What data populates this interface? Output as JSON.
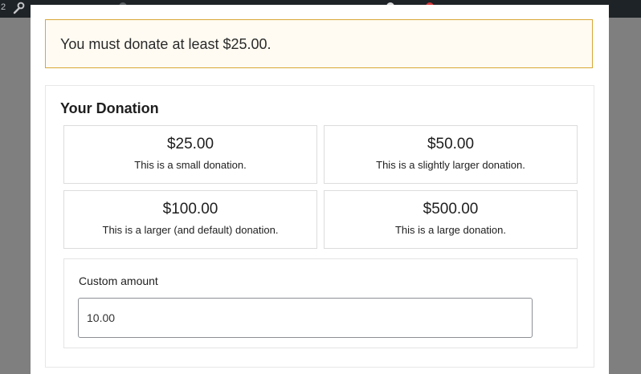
{
  "topbar": {
    "counter": "2",
    "wrench_icon": "wrench-icon",
    "bg_color": "#1d2327"
  },
  "notice": {
    "message": "You must donate at least $25.00.",
    "border_color": "#d9a736"
  },
  "donation": {
    "title": "Your Donation",
    "tiers": [
      {
        "price": "$25.00",
        "description": "This is a small donation."
      },
      {
        "price": "$50.00",
        "description": "This is a slightly larger donation."
      },
      {
        "price": "$100.00",
        "description": "This is a larger (and default) donation."
      },
      {
        "price": "$500.00",
        "description": "This is a large donation."
      }
    ],
    "custom": {
      "label": "Custom amount",
      "value": "10.00"
    }
  }
}
